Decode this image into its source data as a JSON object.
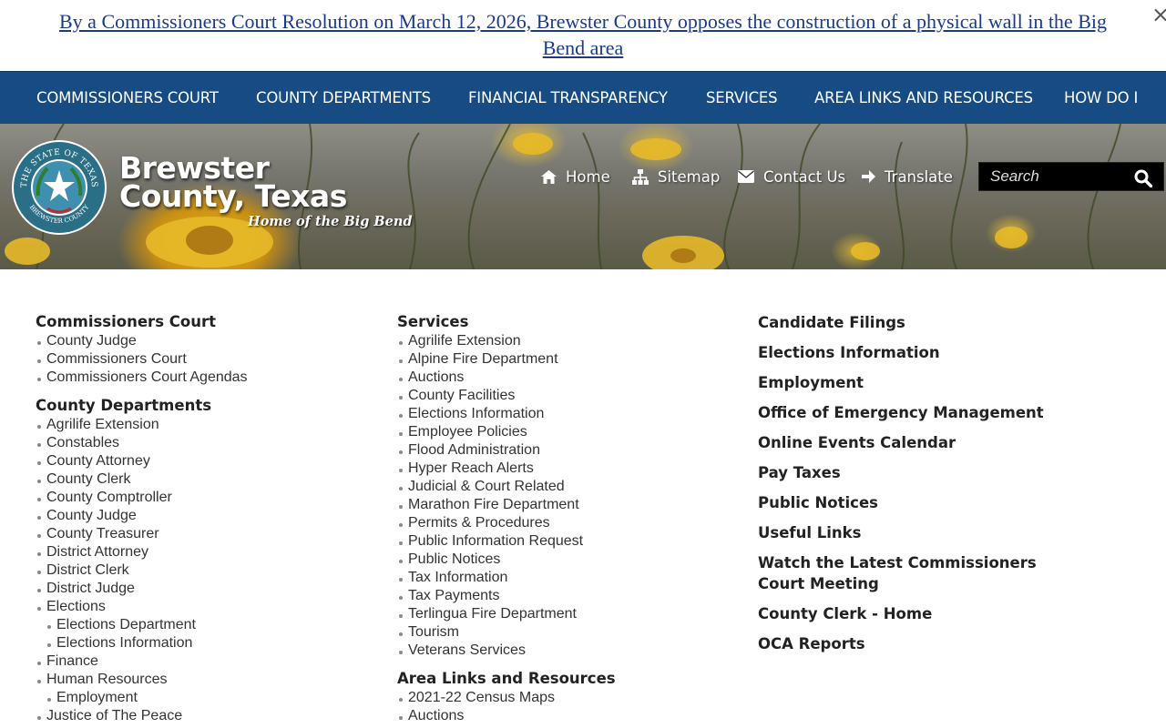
{
  "alert": {
    "text": "By a Commissioners Court Resolution on March 12, 2026, Brewster County opposes the construction of a physical wall in the Big Bend area",
    "close": "×"
  },
  "nav": {
    "items": [
      "COMMISSIONERS COURT",
      "COUNTY DEPARTMENTS",
      "FINANCIAL TRANSPARENCY",
      "SERVICES",
      "AREA LINKS AND RESOURCES",
      "HOW DO I"
    ]
  },
  "header": {
    "title_line1": "Brewster",
    "title_line2": "County, Texas",
    "tagline": "Home of the Big Bend",
    "seal_top_text": "THE STATE OF TEXAS",
    "seal_bottom_text": "BREWSTER COUNTY",
    "links": [
      {
        "label": "Home",
        "icon": "home-icon"
      },
      {
        "label": "Sitemap",
        "icon": "sitemap-icon"
      },
      {
        "label": "Contact Us",
        "icon": "envelope-icon"
      },
      {
        "label": "Translate",
        "icon": "arrow-right-icon"
      }
    ],
    "search_placeholder": "Search"
  },
  "sitemap": {
    "col1": {
      "commissioners": {
        "heading": "Commissioners Court",
        "items": [
          "County Judge",
          "Commissioners Court",
          "Commissioners Court Agendas"
        ]
      },
      "departments": {
        "heading": "County Departments",
        "items": [
          "Agrilife Extension",
          "Constables",
          "County Attorney",
          "County Clerk",
          "County Comptroller",
          "County Judge",
          "County Treasurer",
          "District Attorney",
          "District Clerk",
          "District Judge",
          "Elections",
          "Elections Department",
          "Elections Information",
          "Finance",
          "Human Resources",
          "Employment",
          "Justice of The Peace"
        ]
      }
    },
    "col2": {
      "services": {
        "heading": "Services",
        "items": [
          "Agrilife Extension",
          "Alpine Fire Department",
          "Auctions",
          "County Facilities",
          "Elections Information",
          "Employee Policies",
          "Flood Administration",
          "Hyper Reach Alerts",
          "Judicial & Court Related",
          "Marathon Fire Department",
          "Permits & Procedures",
          "Public Information Request",
          "Public Notices",
          "Tax Information",
          "Tax Payments",
          "Terlingua Fire Department",
          "Tourism",
          "Veterans Services"
        ]
      },
      "area": {
        "heading": "Area Links and Resources",
        "items": [
          "2021-22 Census Maps",
          "Auctions"
        ]
      }
    },
    "col3": {
      "links": [
        "Candidate Filings",
        "Elections Information",
        "Employment",
        "Office of Emergency Management",
        "Online Events Calendar",
        "Pay Taxes",
        "Public Notices",
        "Useful Links",
        "Watch the Latest Commissioners Court Meeting",
        "County Clerk - Home",
        "OCA Reports"
      ]
    }
  },
  "colors": {
    "nav_bg": "#174b83",
    "alert_link": "#1a3a8a",
    "heading": "#222222"
  }
}
